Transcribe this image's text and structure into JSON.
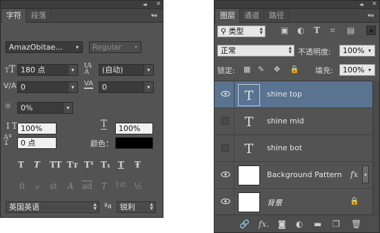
{
  "char_panel": {
    "tabs": [
      "字符",
      "段落"
    ],
    "font_family": "AmazObitae...",
    "font_style": "Regular",
    "font_size": "180 点",
    "leading": "(自动)",
    "kerning": "0",
    "tracking": "0",
    "tsume": "0%",
    "vertical_scale": "100%",
    "horizontal_scale": "100%",
    "baseline_shift": "0 点",
    "color_label": "颜色：",
    "type_styles": [
      "T",
      "T",
      "TT",
      "Tт",
      "T¹",
      "T₁",
      "T",
      "Ŧ"
    ],
    "opentype": [
      "ﬁ",
      "ℴ",
      "st",
      "A",
      "ad",
      "T",
      "1st",
      "½"
    ],
    "language": "英国英语",
    "aa_label": "ªa",
    "antialias": "锐利"
  },
  "layers_panel": {
    "tabs": [
      "图层",
      "通道",
      "路径"
    ],
    "filter_kind": "类型",
    "blend_mode": "正常",
    "opacity_label": "不透明度:",
    "opacity": "100%",
    "lock_label": "锁定:",
    "fill_label": "填充:",
    "fill": "100%",
    "layers": [
      {
        "name": "shine top",
        "kind": "text",
        "visible": true,
        "selected": true
      },
      {
        "name": "shine mid",
        "kind": "text",
        "visible": false,
        "selected": false
      },
      {
        "name": "shine  bot",
        "kind": "text",
        "visible": false,
        "selected": false
      },
      {
        "name": "Background Pattern",
        "kind": "pixel",
        "visible": true,
        "selected": false,
        "fx": "fx"
      },
      {
        "name": "背景",
        "kind": "pixel",
        "visible": true,
        "selected": false,
        "locked": true
      }
    ],
    "bottom_fx": "fx."
  },
  "colors": {
    "panel_bg": "#535353",
    "selected_layer": "#5a7391",
    "field_bg": "#3b3b3b"
  }
}
